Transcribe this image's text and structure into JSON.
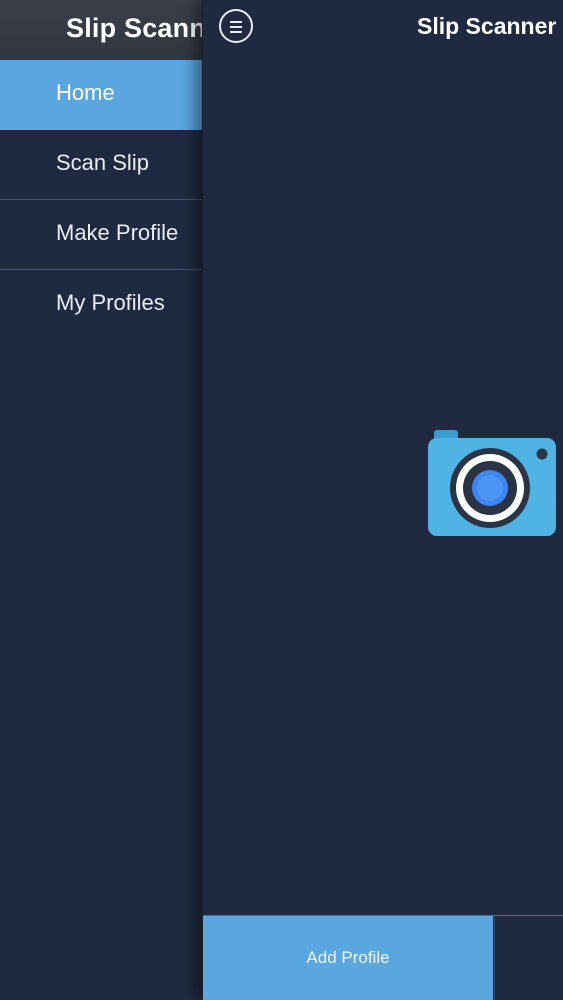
{
  "drawer": {
    "title": "Slip Scanner",
    "items": [
      {
        "label": "Home",
        "active": true
      },
      {
        "label": "Scan Slip",
        "active": false
      },
      {
        "label": "Make Profile",
        "active": false
      },
      {
        "label": "My Profiles",
        "active": false
      }
    ]
  },
  "main": {
    "title": "Slip Scanner",
    "menu_icon": "hamburger-menu-icon",
    "center_icon": "camera-icon",
    "add_profile_label": "Add Profile"
  },
  "colors": {
    "background": "#1f2a40",
    "accent": "#5aa6df",
    "header": "#353a43",
    "camera_body": "#4fb3e3",
    "camera_lens": "#3d86f0"
  }
}
